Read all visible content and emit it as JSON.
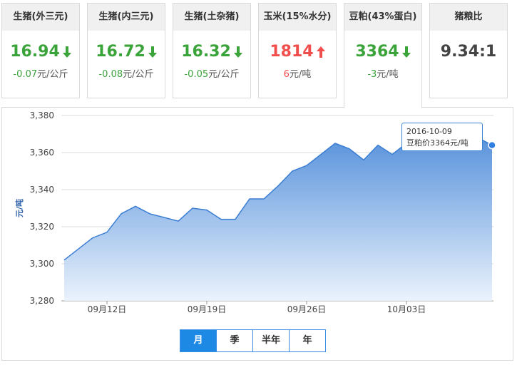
{
  "cards": [
    {
      "title": "生猪(外三元)",
      "value": "16.94",
      "trend": "down",
      "change_value": "-0.07",
      "change_unit": "元/公斤"
    },
    {
      "title": "生猪(内三元)",
      "value": "16.72",
      "trend": "down",
      "change_value": "-0.08",
      "change_unit": "元/公斤"
    },
    {
      "title": "生猪(土杂猪)",
      "value": "16.32",
      "trend": "down",
      "change_value": "-0.05",
      "change_unit": "元/公斤"
    },
    {
      "title": "玉米(15%水分)",
      "value": "1814",
      "trend": "up",
      "change_value": "6",
      "change_unit": "元/吨"
    },
    {
      "title": "豆粕(43%蛋白)",
      "value": "3364",
      "trend": "down",
      "change_value": "-3",
      "change_unit": "元/吨",
      "active": true
    },
    {
      "title": "猪粮比",
      "value": "9.34:1",
      "trend": "neutral",
      "change_value": "",
      "change_unit": ""
    }
  ],
  "colors": {
    "up": "#f04d4d",
    "down": "#3aa33a",
    "accent": "#1e88e5",
    "area_top": "#3a7fd5",
    "area_bottom": "#e8f1fc"
  },
  "tooltip": {
    "date": "2016-10-09",
    "label": "豆粕价3364元/吨"
  },
  "range_buttons": [
    {
      "label": "月",
      "active": true
    },
    {
      "label": "季",
      "active": false
    },
    {
      "label": "半年",
      "active": false
    },
    {
      "label": "年",
      "active": false
    }
  ],
  "chart_data": {
    "type": "area",
    "ylabel": "元/吨",
    "ylim": [
      3280,
      3380
    ],
    "yticks": [
      "3,280",
      "3,300",
      "3,320",
      "3,340",
      "3,360",
      "3,380"
    ],
    "xtick_labels": [
      "09月12日",
      "09月19日",
      "09月26日",
      "10月03日"
    ],
    "x": [
      "09-09",
      "09-10",
      "09-11",
      "09-12",
      "09-13",
      "09-14",
      "09-15",
      "09-16",
      "09-17",
      "09-18",
      "09-19",
      "09-20",
      "09-21",
      "09-22",
      "09-23",
      "09-24",
      "09-25",
      "09-26",
      "09-27",
      "09-28",
      "09-29",
      "09-30",
      "10-01",
      "10-02",
      "10-03",
      "10-04",
      "10-05",
      "10-06",
      "10-07",
      "10-08",
      "10-09"
    ],
    "series": [
      {
        "values": [
          3302,
          3308,
          3314,
          3317,
          3327,
          3331,
          3327,
          3325,
          3323,
          3330,
          3329,
          3324,
          3324,
          3335,
          3335,
          3342,
          3350,
          3353,
          3359,
          3365,
          3362,
          3356,
          3364,
          3359,
          3365,
          3368,
          3370,
          3372,
          3375,
          3368,
          3364
        ]
      }
    ],
    "grid": true,
    "legend": "none"
  }
}
